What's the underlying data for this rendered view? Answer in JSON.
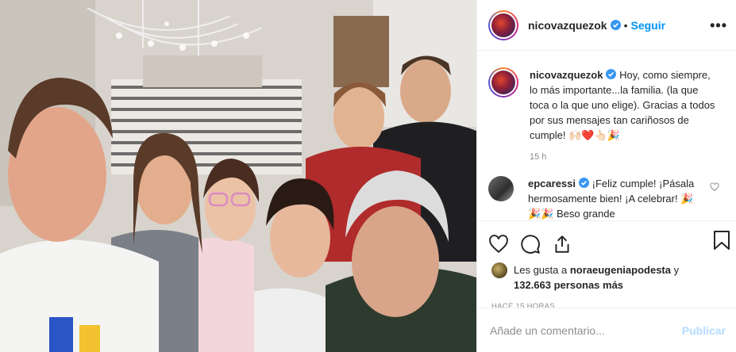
{
  "post": {
    "username": "nicovazquezok",
    "follow_label": "Seguir",
    "more_label": "•••",
    "caption": "Hoy, como siempre, lo más importante...la familia. (la que toca o la que uno elige). Gracias a todos por sus mensajes tan cariñosos de cumple! 🙌🏻❤️👆🏻🎉",
    "time": "15 h"
  },
  "comment": {
    "username": "epcaressi",
    "text": "¡Feliz cumple! ¡Pásala hermosamente bien! ¡A celebrar! 🎉🎉🎉 Beso grande"
  },
  "likes": {
    "prefix": "Les gusta a",
    "user": "noraeugeniapodesta",
    "conj": "y",
    "count": "132.663 personas más"
  },
  "posted_ago": "HACE 15 HORAS",
  "add_comment": {
    "placeholder": "Añade un comentario...",
    "publish_label": "Publicar"
  },
  "colors": {
    "link": "#0095f6",
    "publish_disabled": "#b3dbff",
    "muted": "#8e8e8e"
  }
}
